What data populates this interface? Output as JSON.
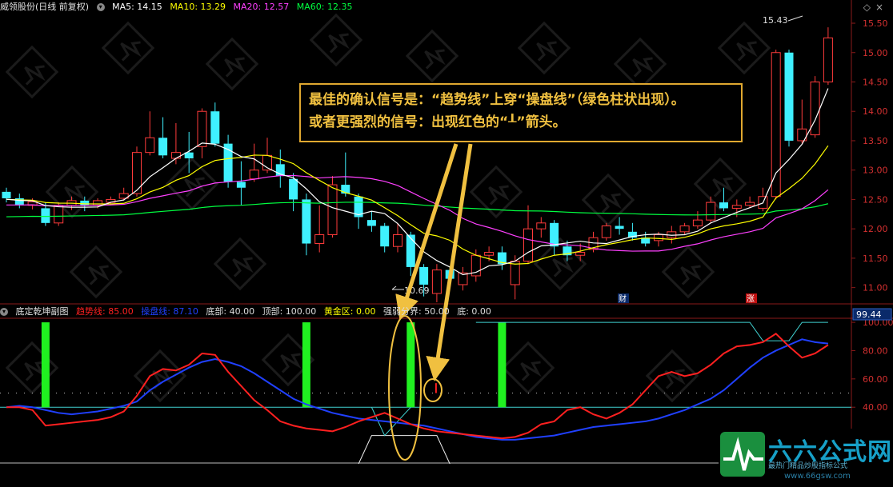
{
  "top": {
    "title": "威领股份(日线 前复权)",
    "ma5": "MA5: 14.15",
    "ma10": "MA10: 13.29",
    "ma20": "MA20: 12.57",
    "ma60": "MA60: 12.35",
    "high_label": "15.43",
    "low_label": "10.69",
    "price_ticks": [
      "15.50",
      "15.00",
      "14.50",
      "14.00",
      "13.50",
      "13.00",
      "12.50",
      "12.00",
      "11.50",
      "11.00"
    ],
    "marker_cai": "财",
    "marker_zhang": "涨"
  },
  "sub": {
    "title": "底定乾坤副图",
    "trend": "趋势线: 85.00",
    "operate": "操盘线: 87.10",
    "bottom": "底部: 40.00",
    "top_v": "顶部: 100.00",
    "gold": "黄金区: 0.00",
    "strength": "强弱分界: 50.00",
    "bottom2": "底: 0.00",
    "value_box": "99.44",
    "ticks": [
      "100.00",
      "80.00",
      "60.00",
      "40.00",
      "20.00"
    ]
  },
  "callout": {
    "line1": "最佳的确认信号是：“趋势线”上穿“操盘线”（绿色柱状出现）。",
    "line2": "或者更强烈的信号：出现红色的“┸”箭头。"
  },
  "logo": {
    "name": "六六公式网",
    "slogan": "最热门精品炒股指标公式",
    "url": "www.66gsw.com"
  },
  "colors": {
    "up": "#ff3b3b",
    "down": "#3ff0ff",
    "ma5": "#ffffff",
    "ma10": "#ffff00",
    "ma20": "#ff40ff",
    "ma60": "#00ff40",
    "trend": "#ff2020",
    "operate": "#2040ff",
    "callout": "#f0c040"
  },
  "candles": [
    {
      "o": 12.63,
      "c": 12.52,
      "h": 12.7,
      "l": 12.45
    },
    {
      "o": 12.52,
      "c": 12.4,
      "h": 12.6,
      "l": 12.35
    },
    {
      "o": 12.4,
      "c": 12.46,
      "h": 12.52,
      "l": 12.33
    },
    {
      "o": 12.35,
      "c": 12.1,
      "h": 12.45,
      "l": 12.05
    },
    {
      "o": 12.1,
      "c": 12.4,
      "h": 12.45,
      "l": 12.05
    },
    {
      "o": 12.4,
      "c": 12.48,
      "h": 12.55,
      "l": 12.32
    },
    {
      "o": 12.48,
      "c": 12.4,
      "h": 12.55,
      "l": 12.3
    },
    {
      "o": 12.4,
      "c": 12.48,
      "h": 12.52,
      "l": 12.35
    },
    {
      "o": 12.45,
      "c": 12.5,
      "h": 12.55,
      "l": 12.4
    },
    {
      "o": 12.52,
      "c": 12.6,
      "h": 12.7,
      "l": 12.48
    },
    {
      "o": 12.6,
      "c": 13.3,
      "h": 13.4,
      "l": 12.55
    },
    {
      "o": 13.3,
      "c": 13.55,
      "h": 14.0,
      "l": 13.25
    },
    {
      "o": 13.55,
      "c": 13.25,
      "h": 13.9,
      "l": 13.2
    },
    {
      "o": 13.2,
      "c": 13.3,
      "h": 13.8,
      "l": 13.1
    },
    {
      "o": 13.3,
      "c": 13.2,
      "h": 13.65,
      "l": 12.95
    },
    {
      "o": 13.4,
      "c": 14.0,
      "h": 14.05,
      "l": 13.2
    },
    {
      "o": 14.0,
      "c": 13.45,
      "h": 14.15,
      "l": 13.4
    },
    {
      "o": 13.45,
      "c": 12.8,
      "h": 13.6,
      "l": 12.7
    },
    {
      "o": 12.8,
      "c": 12.7,
      "h": 13.15,
      "l": 12.4
    },
    {
      "o": 12.85,
      "c": 13.0,
      "h": 13.45,
      "l": 12.8
    },
    {
      "o": 13.0,
      "c": 13.25,
      "h": 13.55,
      "l": 12.95
    },
    {
      "o": 13.1,
      "c": 12.9,
      "h": 13.35,
      "l": 12.7
    },
    {
      "o": 12.85,
      "c": 12.5,
      "h": 12.95,
      "l": 12.3
    },
    {
      "o": 12.5,
      "c": 11.75,
      "h": 12.6,
      "l": 11.55
    },
    {
      "o": 11.75,
      "c": 11.9,
      "h": 12.4,
      "l": 11.6
    },
    {
      "o": 11.9,
      "c": 12.75,
      "h": 12.9,
      "l": 11.85
    },
    {
      "o": 12.75,
      "c": 12.6,
      "h": 13.3,
      "l": 12.55
    },
    {
      "o": 12.55,
      "c": 12.2,
      "h": 12.6,
      "l": 12.0
    },
    {
      "o": 12.15,
      "c": 12.05,
      "h": 12.3,
      "l": 11.95
    },
    {
      "o": 12.05,
      "c": 11.7,
      "h": 12.1,
      "l": 11.6
    },
    {
      "o": 11.7,
      "c": 11.9,
      "h": 12.1,
      "l": 11.6
    },
    {
      "o": 11.9,
      "c": 11.35,
      "h": 11.95,
      "l": 11.2
    },
    {
      "o": 11.35,
      "c": 11.05,
      "h": 11.4,
      "l": 10.85
    },
    {
      "o": 10.9,
      "c": 11.3,
      "h": 11.4,
      "l": 10.75
    },
    {
      "o": 11.3,
      "c": 11.15,
      "h": 11.35,
      "l": 11.05
    },
    {
      "o": 11.05,
      "c": 11.25,
      "h": 11.35,
      "l": 10.95
    },
    {
      "o": 11.2,
      "c": 11.55,
      "h": 11.65,
      "l": 11.1
    },
    {
      "o": 11.55,
      "c": 11.6,
      "h": 11.7,
      "l": 11.45
    },
    {
      "o": 11.6,
      "c": 11.4,
      "h": 11.7,
      "l": 11.3
    },
    {
      "o": 11.05,
      "c": 11.45,
      "h": 11.55,
      "l": 10.8
    },
    {
      "o": 11.45,
      "c": 12.0,
      "h": 12.4,
      "l": 11.4
    },
    {
      "o": 12.0,
      "c": 12.1,
      "h": 12.2,
      "l": 11.85
    },
    {
      "o": 12.1,
      "c": 11.7,
      "h": 12.15,
      "l": 11.55
    },
    {
      "o": 11.7,
      "c": 11.55,
      "h": 11.8,
      "l": 11.45
    },
    {
      "o": 11.55,
      "c": 11.6,
      "h": 11.75,
      "l": 11.45
    },
    {
      "o": 11.65,
      "c": 11.85,
      "h": 11.95,
      "l": 11.6
    },
    {
      "o": 11.85,
      "c": 12.05,
      "h": 12.1,
      "l": 11.8
    },
    {
      "o": 12.05,
      "c": 12.0,
      "h": 12.2,
      "l": 11.9
    },
    {
      "o": 11.95,
      "c": 11.85,
      "h": 12.1,
      "l": 11.8
    },
    {
      "o": 11.85,
      "c": 11.75,
      "h": 11.95,
      "l": 11.7
    },
    {
      "o": 11.8,
      "c": 11.9,
      "h": 11.95,
      "l": 11.7
    },
    {
      "o": 11.85,
      "c": 11.95,
      "h": 12.05,
      "l": 11.75
    },
    {
      "o": 11.95,
      "c": 12.05,
      "h": 12.1,
      "l": 11.9
    },
    {
      "o": 12.05,
      "c": 12.15,
      "h": 12.3,
      "l": 12.0
    },
    {
      "o": 12.15,
      "c": 12.45,
      "h": 12.55,
      "l": 12.1
    },
    {
      "o": 12.45,
      "c": 12.35,
      "h": 12.7,
      "l": 12.3
    },
    {
      "o": 12.35,
      "c": 12.4,
      "h": 12.5,
      "l": 12.2
    },
    {
      "o": 12.4,
      "c": 12.45,
      "h": 12.55,
      "l": 12.35
    },
    {
      "o": 12.35,
      "c": 12.55,
      "h": 12.7,
      "l": 12.3
    },
    {
      "o": 12.55,
      "c": 15.0,
      "h": 15.05,
      "l": 12.5
    },
    {
      "o": 15.0,
      "c": 13.5,
      "h": 15.05,
      "l": 13.4
    },
    {
      "o": 13.5,
      "c": 13.7,
      "h": 14.2,
      "l": 13.45
    },
    {
      "o": 13.6,
      "c": 14.5,
      "h": 14.6,
      "l": 13.55
    },
    {
      "o": 14.5,
      "c": 15.25,
      "h": 15.43,
      "l": 14.45
    }
  ],
  "trend_line": [
    40,
    40,
    38,
    27,
    28,
    29,
    30,
    31,
    33,
    37,
    48,
    62,
    67,
    66,
    70,
    78,
    77,
    65,
    55,
    45,
    38,
    30,
    27,
    25,
    24,
    23,
    26,
    30,
    33,
    36,
    32,
    28,
    25,
    23,
    22,
    21,
    20,
    19,
    18,
    19,
    22,
    28,
    30,
    38,
    40,
    35,
    32,
    36,
    42,
    52,
    62,
    65,
    62,
    64,
    70,
    78,
    83,
    84,
    86,
    92,
    83,
    75,
    78,
    84
  ],
  "operate_line": [
    40,
    41,
    40,
    38,
    36,
    35,
    36,
    37,
    39,
    41,
    44,
    52,
    58,
    63,
    68,
    72,
    74,
    72,
    69,
    64,
    58,
    52,
    46,
    42,
    39,
    36,
    34,
    32,
    31,
    30,
    29,
    28,
    27,
    25,
    23,
    21,
    19,
    18,
    17,
    17,
    18,
    19,
    20,
    22,
    24,
    26,
    27,
    28,
    29,
    30,
    32,
    35,
    38,
    42,
    46,
    52,
    60,
    68,
    75,
    80,
    84,
    88,
    86,
    85
  ],
  "green_bars": [
    3,
    23,
    31,
    38
  ]
}
